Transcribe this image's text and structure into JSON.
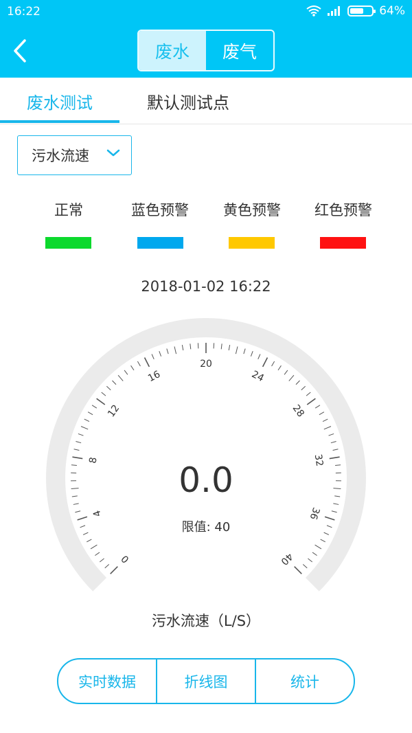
{
  "status_bar": {
    "time": "16:22",
    "battery_text": "64%",
    "battery_level": 0.64
  },
  "nav": {
    "back_icon": "chevron-left-icon",
    "segments": [
      {
        "label": "废水",
        "active": true
      },
      {
        "label": "废气",
        "active": false
      }
    ]
  },
  "tabs": [
    {
      "label": "废水测试",
      "active": true
    },
    {
      "label": "默认测试点",
      "active": false
    }
  ],
  "metric_select": {
    "value": "污水流速",
    "icon": "chevron-down-icon"
  },
  "legend": [
    {
      "label": "正常",
      "color": "#0CD92D"
    },
    {
      "label": "蓝色预警",
      "color": "#00A8EE"
    },
    {
      "label": "黄色预警",
      "color": "#FFC800"
    },
    {
      "label": "红色预警",
      "color": "#FF1212"
    }
  ],
  "timestamp": "2018-01-02 16:22",
  "gauge": {
    "value": "0.0",
    "limit_text": "限值: 40",
    "title": "污水流速（L/S）",
    "min": 0,
    "max": 40,
    "tick_labels": [
      "0",
      "4",
      "8",
      "12",
      "16",
      "20",
      "24",
      "28",
      "32",
      "36",
      "40"
    ],
    "ring_color": "#EBEBEB"
  },
  "bottom_buttons": [
    {
      "label": "实时数据"
    },
    {
      "label": "折线图"
    },
    {
      "label": "统计"
    }
  ]
}
